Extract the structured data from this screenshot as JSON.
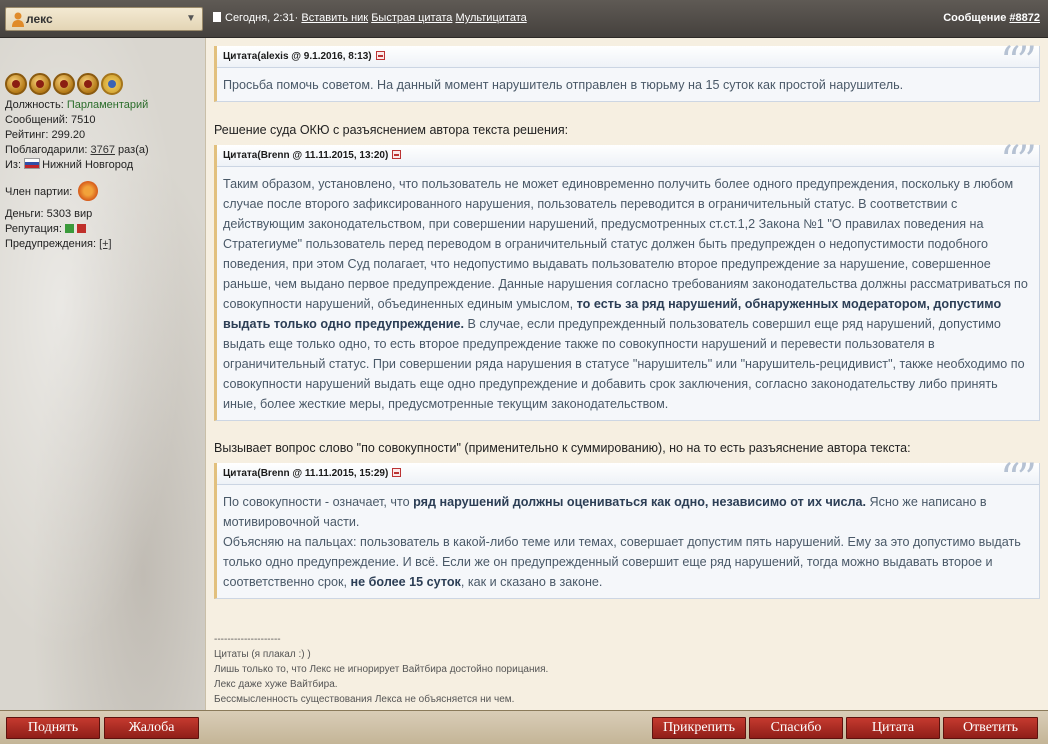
{
  "header": {
    "username": "лекс",
    "post_date": "Сегодня, 2:31·",
    "link_insert_nick": "Вставить ник",
    "link_quick_quote": "Быстрая цитата",
    "link_multiquote": "Мультицитата",
    "post_label": "Сообщение",
    "post_number": "#8872"
  },
  "profile": {
    "position_label": "Должность:",
    "position_value": "Парламентарий",
    "messages": "Сообщений: 7510",
    "rating": "Рейтинг: 299.20",
    "thanks_label": "Поблагодарили:",
    "thanks_value": "3767",
    "thanks_suffix": "раз(а)",
    "from_label": "Из:",
    "from_value": "Нижний Новгород",
    "party_label": "Член партии:",
    "money": "Деньги: 5303 вир",
    "reputation": "Репутация:",
    "warnings_label": "Предупреждения:",
    "warnings_value": "[+]"
  },
  "post": {
    "quote1_title": "Цитата(alexis @ 9.1.2016, 8:13)",
    "quote1_text": "Просьба помочь советом. На данный момент нарушитель отправлен в тюрьму на 15 суток как простой нарушитель.",
    "para1": "Решение суда ОКЮ с разъяснением автора текста решения:",
    "quote2_title": "Цитата(Brenn @ 11.11.2015, 13:20)",
    "quote2_text_a": "Таким образом, установлено, что пользователь не может единовременно получить более одного предупреждения, поскольку в любом случае после второго зафиксированного нарушения, пользователь переводится в ограничительный статус. В соответствии с действующим законодательством, при совершении нарушений, предусмотренных ст.ст.1,2 Закона №1 \"О правилах поведения на Стратегиуме\" пользователь перед переводом в ограничительный статус должен быть предупрежден о недопустимости подобного поведения, при этом Суд полагает, что недопустимо выдавать пользователю второе предупреждение за нарушение, совершенное раньше, чем выдано первое предупреждение. Данные нарушения согласно требованиям законодательства должны рассматриваться по совокупности нарушений, объединенных единым умыслом, ",
    "quote2_text_bold": "то есть за ряд нарушений, обнаруженных модератором, допустимо выдать только одно предупреждение.",
    "quote2_text_b": " В случае, если предупрежденный пользователь совершил еще ряд нарушений, допустимо выдать еще только одно, то есть второе предупреждение также по совокупности нарушений и перевести пользователя в ограничительный статус. При совершении ряда нарушения в статусе \"нарушитель\" или \"нарушитель-рецидивист\", также необходимо по совокупности нарушений выдать еще одно предупреждение и добавить срок заключения, согласно законодательству либо принять иные, более жесткие меры, предусмотренные текущим законодательством.",
    "para2": "Вызывает вопрос слово \"по совокупности\" (применительно к суммированию), но на то есть разъяснение автора текста:",
    "quote3_title": "Цитата(Brenn @ 11.11.2015, 15:29)",
    "quote3_line1_a": "По совокупности - означает, что ",
    "quote3_line1_bold": "ряд нарушений должны оцениваться как одно, независимо от их числа.",
    "quote3_line1_b": " Ясно же написано в мотивировочной части.",
    "quote3_line2_a": "Объясняю на пальцах: пользователь в какой-либо теме или темах, совершает допустим пять нарушений. Ему за это допустимо выдать только одно предупреждение. И всё. Если же он предупрежденный совершит еще ряд нарушений, тогда можно выдавать второе и соответственно срок, ",
    "quote3_line2_bold": "не более 15 суток",
    "quote3_line2_b": ", как и сказано в законе."
  },
  "signature": {
    "divider": "--------------------",
    "line1": "Цитаты (я плакал :) )",
    "line2": "Лишь только то, что Лекс не игнорирует Вайтбира достойно порицания.",
    "line3": "Лекс даже хуже Вайтбира.",
    "line4": "Бессмысленность существования Лекса не объясняется ни чем."
  },
  "buttons": {
    "raise": "Поднять",
    "complaint": "Жалоба",
    "attach": "Прикрепить",
    "thanks": "Спасибо",
    "quote": "Цитата",
    "reply": "Ответить"
  },
  "quote_marks": "“”"
}
